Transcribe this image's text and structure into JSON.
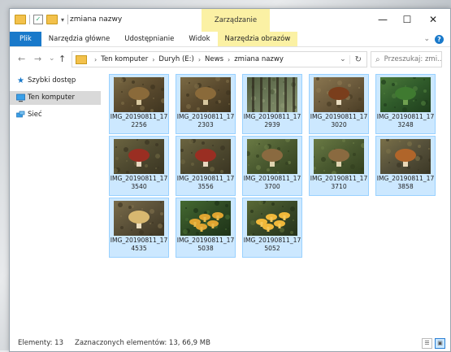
{
  "window": {
    "title": "zmiana nazwy",
    "context_header": "Zarządzanie",
    "minimize": "—",
    "maximize": "☐",
    "close": "✕"
  },
  "ribbon": {
    "tabs": [
      "Plik",
      "Narzędzia główne",
      "Udostępnianie",
      "Widok",
      "Narzędzia obrazów"
    ],
    "collapse": "⌄",
    "help": "?"
  },
  "address": {
    "back": "←",
    "forward": "→",
    "recent": "⌄",
    "up": "↑",
    "crumbs": [
      "Ten komputer",
      "Duryh (E:)",
      "News",
      "zmiana nazwy"
    ],
    "dropdown": "⌄",
    "refresh": "↻",
    "search_placeholder": "Przeszukaj: zmi..."
  },
  "navpane": {
    "items": [
      {
        "label": "Szybki dostęp",
        "icon": "star-icon"
      },
      {
        "label": "Ten komputer",
        "icon": "computer-icon"
      },
      {
        "label": "Sieć",
        "icon": "network-icon"
      }
    ]
  },
  "files": [
    {
      "name1": "IMG_20190811_17",
      "name2": "2256",
      "scene": "forest-floor-mushrooms"
    },
    {
      "name1": "IMG_20190811_17",
      "name2": "2303",
      "scene": "forest-floor-mushrooms"
    },
    {
      "name1": "IMG_20190811_17",
      "name2": "2939",
      "scene": "forest-trees"
    },
    {
      "name1": "IMG_20190811_17",
      "name2": "3020",
      "scene": "brown-mushroom"
    },
    {
      "name1": "IMG_20190811_17",
      "name2": "3248",
      "scene": "green-plants"
    },
    {
      "name1": "IMG_20190811_17",
      "name2": "3540",
      "scene": "red-cap-mushroom"
    },
    {
      "name1": "IMG_20190811_17",
      "name2": "3556",
      "scene": "red-cap-mushroom"
    },
    {
      "name1": "IMG_20190811_17",
      "name2": "3700",
      "scene": "mushroom-moss"
    },
    {
      "name1": "IMG_20190811_17",
      "name2": "3710",
      "scene": "mushroom-moss"
    },
    {
      "name1": "IMG_20190811_17",
      "name2": "3858",
      "scene": "orange-mushroom"
    },
    {
      "name1": "IMG_20190811_17",
      "name2": "4535",
      "scene": "pale-mushroom"
    },
    {
      "name1": "IMG_20190811_17",
      "name2": "5038",
      "scene": "chanterelles"
    },
    {
      "name1": "IMG_20190811_17",
      "name2": "5052",
      "scene": "chanterelles-bright"
    }
  ],
  "status": {
    "count": "Elementy: 13",
    "selected": "Zaznaczonych elementów: 13, 66,9 MB"
  },
  "colors": {
    "accent": "#1979ca",
    "selection_fill": "#cce8ff",
    "selection_border": "#99d1ff",
    "context_tab": "#fbf1a4"
  }
}
